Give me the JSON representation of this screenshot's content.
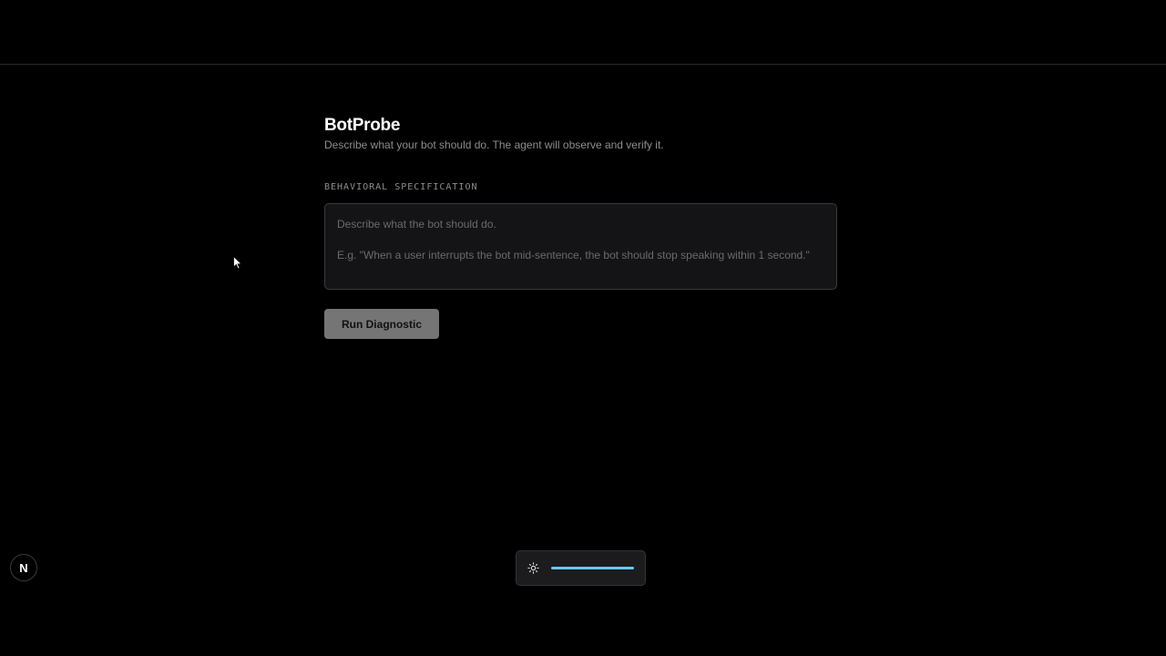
{
  "app": {
    "title": "BotProbe",
    "subtitle": "Describe what your bot should do. The agent will observe and verify it."
  },
  "spec": {
    "label": "BEHAVIORAL SPECIFICATION",
    "value": "",
    "placeholder": "Describe what the bot should do.\n\nE.g. \"When a user interrupts the bot mid-sentence, the bot should stop speaking within 1 second.\""
  },
  "actions": {
    "run_label": "Run Diagnostic"
  },
  "badge": {
    "letter": "N",
    "icon": "nextjs-logo-icon"
  },
  "brightness": {
    "icon": "sun-icon",
    "level": 1.0,
    "accent": "#6ac8f0"
  },
  "colors": {
    "background": "#000000",
    "button": "#757575",
    "muted_text": "#8d8d8d"
  }
}
